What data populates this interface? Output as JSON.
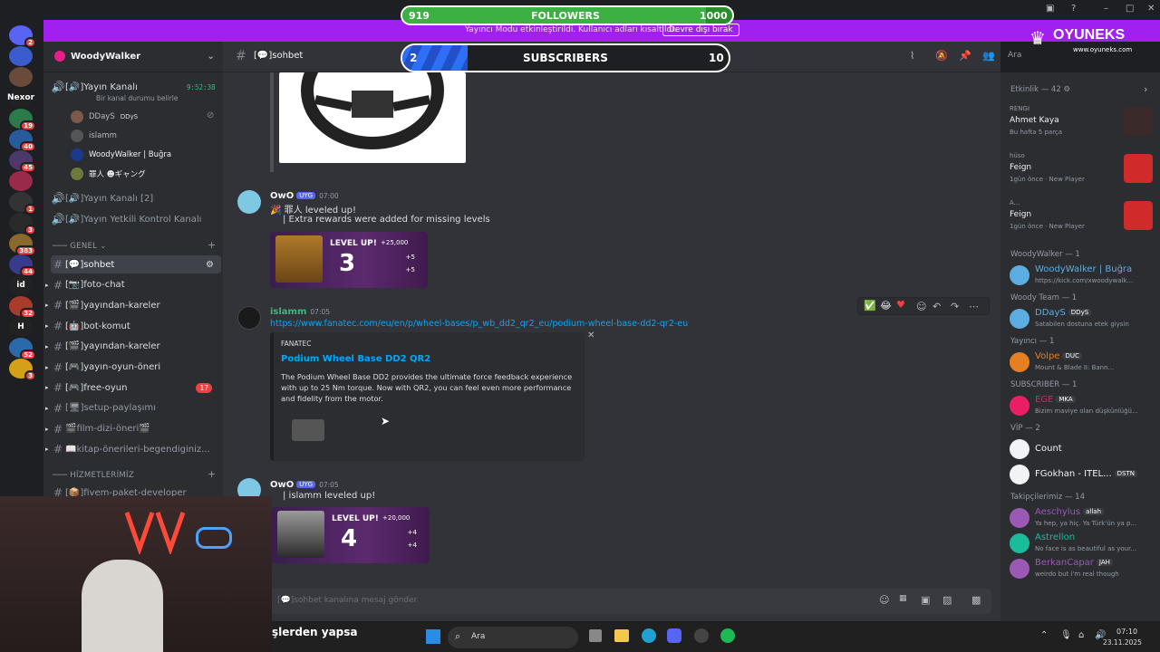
{
  "overlay": {
    "followers": {
      "current": "919",
      "label": "FOLLOWERS",
      "goal": "1000",
      "progress": 0.919
    },
    "subscribers": {
      "current": "2",
      "label": "SUBSCRIBERS",
      "goal": "10",
      "progress": 0.2
    },
    "brand": {
      "name": "OYUNEKS",
      "url": "www.oyuneks.com"
    }
  },
  "banner": {
    "text": "Yayıncı Modu etkinleştirildi. Kullanıcı adları kısaltıldı.",
    "button": "Devre dışı bırak"
  },
  "servers": [
    {
      "label": "",
      "badge": "2"
    },
    {
      "label": "",
      "badge": ""
    },
    {
      "label": "",
      "badge": ""
    },
    {
      "label": "Nexor",
      "badge": ""
    },
    {
      "label": "",
      "badge": "19"
    },
    {
      "label": "",
      "badge": "40"
    },
    {
      "label": "",
      "badge": "45"
    },
    {
      "label": "",
      "badge": ""
    },
    {
      "label": "",
      "badge": "1"
    },
    {
      "label": "",
      "badge": "3"
    },
    {
      "label": "",
      "badge": "383"
    },
    {
      "label": "",
      "badge": "44"
    },
    {
      "label": "id",
      "badge": ""
    },
    {
      "label": "",
      "badge": "32"
    },
    {
      "label": "H",
      "badge": ""
    },
    {
      "label": "",
      "badge": "52"
    },
    {
      "label": "",
      "badge": "3"
    }
  ],
  "sidebar": {
    "guild_name": "WoodyWalker",
    "voice_channel": {
      "name": "[🔊]Yayın Kanalı",
      "status": "Bir kanal durumu belirle",
      "timer": "9:52:38",
      "users": [
        "DDayS",
        "islamm",
        "WoodyWalker | Buğra",
        "罪人 ☻ギャング"
      ],
      "user_tag": "DDyS"
    },
    "other_voice": [
      "[🔊]Yayın Kanalı [2]",
      "[🔊]Yayın Yetkili Kontrol Kanalı"
    ],
    "category1": "GENEL",
    "channels": [
      {
        "name": "[💬]sohbet",
        "active": true,
        "badge": ""
      },
      {
        "name": "[📷]foto-chat",
        "active": false,
        "badge": ""
      },
      {
        "name": "[🎬]yayından-kareler",
        "active": false,
        "badge": ""
      },
      {
        "name": "[🤖]bot-komut",
        "active": false,
        "badge": ""
      },
      {
        "name": "[🎬]yayından-kareler",
        "active": false,
        "badge": ""
      },
      {
        "name": "[🎮]yayın-oyun-öneri",
        "active": false,
        "badge": ""
      },
      {
        "name": "[🎮]free-oyun",
        "active": false,
        "badge": "17"
      },
      {
        "name": "[🖥]setup-paylaşımı",
        "active": false,
        "badge": ""
      },
      {
        "name": "🎬film-dizi-öneri🎬",
        "active": false,
        "badge": ""
      },
      {
        "name": "📖kitap-önerileri-begendiginiz...",
        "active": false,
        "badge": ""
      }
    ],
    "category2": "HİZMETLERİMİZ",
    "channels2": [
      {
        "name": "[📦]fivem-paket-developer"
      }
    ]
  },
  "main": {
    "channel_title": "[💬]sohbet",
    "search_placeholder": "Ara",
    "messages": [
      {
        "author": "OwO",
        "tag": "UYG",
        "time": "07:00",
        "line1": "罪人 leveled up!",
        "line2": "| Extra rewards were added for missing levels",
        "card": {
          "title": "LEVEL UP!",
          "level": "3",
          "r1": "+25,000",
          "r2": "+5",
          "r3": "+5"
        }
      },
      {
        "author": "islamm",
        "time": "07:05",
        "link": "https://www.fanatec.com/eu/en/p/wheel-bases/p_wb_dd2_qr2_eu/podium-wheel-base-dd2-qr2-eu",
        "embed": {
          "provider": "FANATEC",
          "title": "Podium Wheel Base DD2 QR2",
          "description": "The Podium Wheel Base DD2 provides the ultimate force feedback experience with up to 25 Nm torque. Now with QR2, you can feel even more performance and fidelity from the motor."
        }
      },
      {
        "author": "OwO",
        "tag": "UYG",
        "time": "07:05",
        "line1": "| islamm leveled up!",
        "card": {
          "title": "LEVEL UP!",
          "level": "4",
          "r1": "+20,000",
          "r2": "+4",
          "r3": "+4"
        }
      }
    ],
    "composer_placeholder": "[💬]sohbet kanalına mesaj gönder"
  },
  "members": {
    "activity_header": "Etkinlik — 42",
    "activity": [
      {
        "name": "Ahmet Kaya",
        "status": "Bu hafta 5 parça",
        "top": "RENGI"
      },
      {
        "name": "Feign",
        "status": "1gün önce · New Player",
        "top": "hüso"
      },
      {
        "name": "Feign",
        "status": "1gün önce · New Player",
        "top": "A..."
      }
    ],
    "groups": [
      {
        "header": "WoodyWalker — 1",
        "members": [
          {
            "name": "WoodyWalker | Buğra",
            "status": "https://kick.com/xwoodywalk...",
            "color": "#5dade2"
          }
        ]
      },
      {
        "header": "Woody Team — 1",
        "members": [
          {
            "name": "DDayS",
            "tag": "DDyS",
            "status": "Satabilen dostuna etek giysin",
            "color": "#5dade2"
          }
        ]
      },
      {
        "header": "Yayıncı — 1",
        "members": [
          {
            "name": "Volpe",
            "tag": "DUC",
            "status": "Mount & Blade II: Bann...",
            "color": "#e67e22"
          }
        ]
      },
      {
        "header": "SUBSCRIBER — 1",
        "members": [
          {
            "name": "EGE",
            "tag": "MKA",
            "status": "Bizim maviye olan düşkünlüğü...",
            "color": "#e91e63"
          }
        ]
      },
      {
        "header": "VİP — 2",
        "members": [
          {
            "name": "Count",
            "tag": "",
            "status": "",
            "color": "#f2f3f5"
          },
          {
            "name": "FGokhan - ITEL...",
            "tag": "DSTN",
            "status": "",
            "color": "#f2f3f5"
          }
        ]
      },
      {
        "header": "Takipçilerimiz — 14",
        "members": [
          {
            "name": "Aeschylus",
            "tag": "allah",
            "status": "Ya hep, ya hiç. Ya Türk'ün ya p...",
            "color": "#9b59b6"
          },
          {
            "name": "Astrellon",
            "tag": "",
            "status": "No face is as beautiful as your...",
            "color": "#1abc9c"
          },
          {
            "name": "BerkanCapar",
            "tag": "JAH",
            "status": "weirdo but i'm real though",
            "color": "#9b59b6"
          }
        ]
      }
    ]
  },
  "taskbar": {
    "search": "Ara",
    "time": "07:10",
    "date": "23.11.2025",
    "caption": "şlerden yapsa"
  },
  "colors": {
    "accent": "#5865f2",
    "banner": "#a020f0",
    "followers_bar": "#3cb043",
    "subs_bar": "#2f6ff5",
    "link": "#00a8fc",
    "green_name": "#43b581"
  }
}
